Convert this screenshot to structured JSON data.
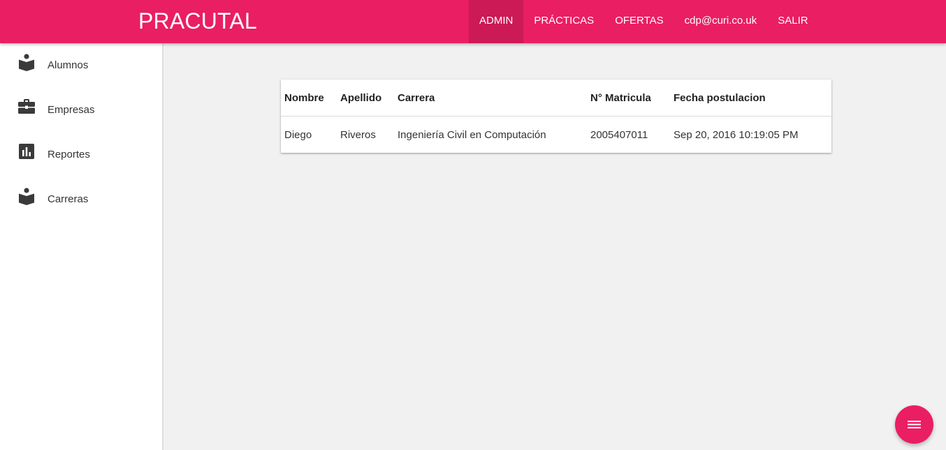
{
  "header": {
    "brand": "PRACUTAL",
    "nav": [
      {
        "label": "ADMIN",
        "active": true
      },
      {
        "label": "PRÁCTICAS",
        "active": false
      },
      {
        "label": "OFERTAS",
        "active": false
      },
      {
        "label": "cdp@curi.co.uk",
        "active": false
      },
      {
        "label": "SALIR",
        "active": false
      }
    ]
  },
  "sidebar": {
    "items": [
      {
        "label": "Alumnos",
        "icon": "reader-icon"
      },
      {
        "label": "Empresas",
        "icon": "briefcase-icon"
      },
      {
        "label": "Reportes",
        "icon": "bar-chart-icon"
      },
      {
        "label": "Carreras",
        "icon": "reader-icon"
      }
    ]
  },
  "table": {
    "columns": [
      "Nombre",
      "Apellido",
      "Carrera",
      "N° Matricula",
      "Fecha postulacion"
    ],
    "rows": [
      [
        "Diego",
        "Riveros",
        "Ingeniería Civil en Computación",
        "2005407011",
        "Sep 20, 2016 10:19:05 PM"
      ]
    ]
  },
  "fab": {
    "icon": "menu-icon"
  },
  "colors": {
    "primary": "#ea1e63",
    "primary_dark": "#cb1a55",
    "background": "#f1f1f1",
    "icon": "#3a3a3a"
  }
}
